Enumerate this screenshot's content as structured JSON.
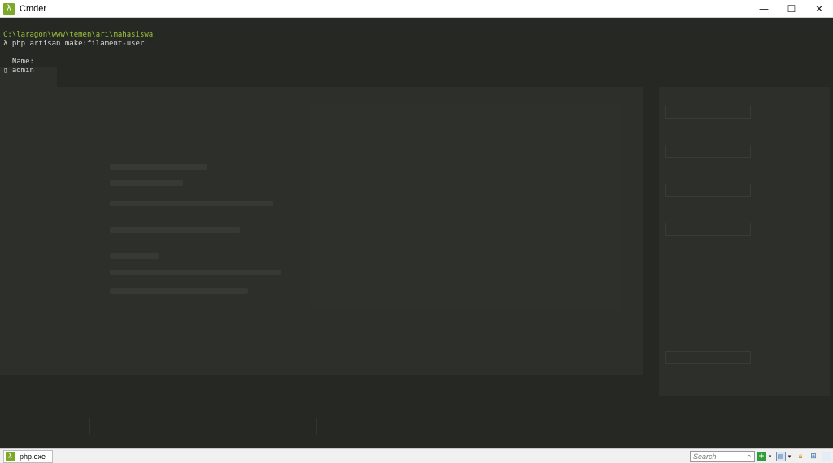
{
  "window": {
    "title": "Cmder",
    "controls": {
      "minimize": "—",
      "maximize": "☐",
      "close": "✕"
    }
  },
  "terminal": {
    "path": "C:\\laragon\\www\\temen\\ari\\mahasiswa",
    "prompt": "λ",
    "command": "php artisan make:filament-user",
    "name_label": "Name:",
    "input_marker": "▯",
    "input_value": "admin"
  },
  "statusbar": {
    "tab_label": "php.exe",
    "search_placeholder": "Search"
  },
  "colors": {
    "path": "#9ec43a",
    "background": "#262824",
    "text": "#d6d6d6",
    "accent": "#7ea82a"
  },
  "icons": {
    "app": "cmder-lambda-icon",
    "search": "search-icon",
    "new_console": "plus-icon",
    "console_list": "console-icon",
    "lock": "lock-icon",
    "windows": "windows-icon",
    "split": "split-view-icon"
  }
}
